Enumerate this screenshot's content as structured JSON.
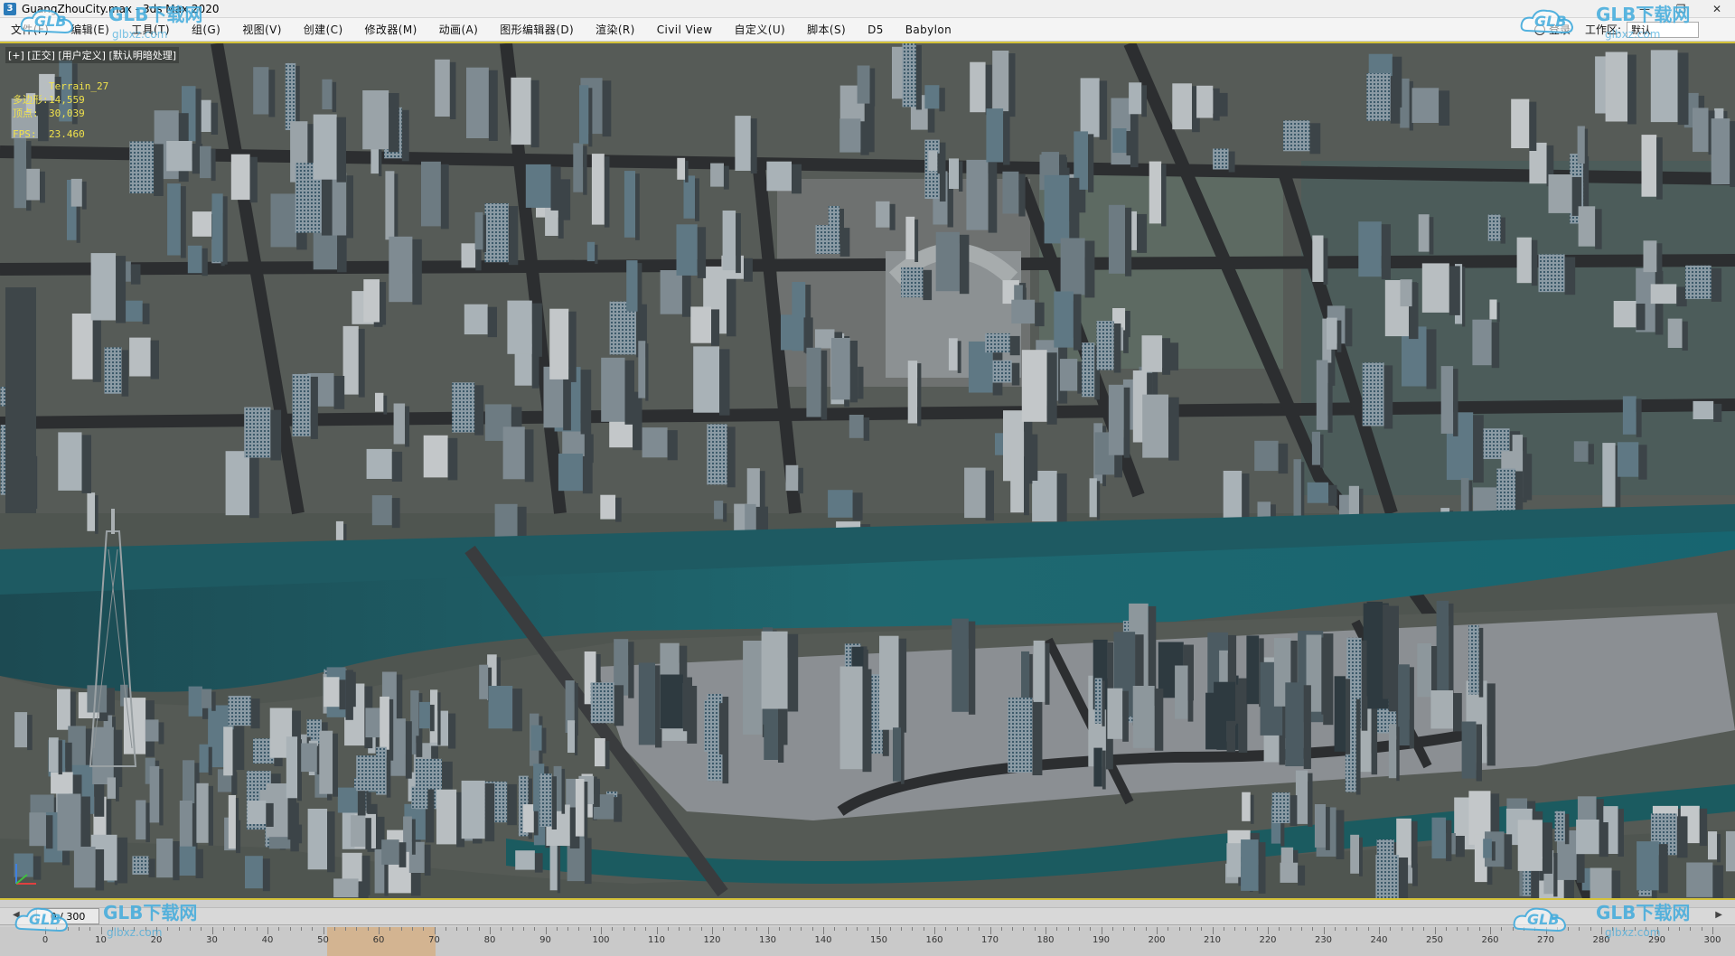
{
  "window": {
    "title": "GuangZhouCity.max - 3ds Max 2020",
    "app_icon": "3"
  },
  "menubar": {
    "items": [
      "文件(F)",
      "编辑(E)",
      "工具(T)",
      "组(G)",
      "视图(V)",
      "创建(C)",
      "修改器(M)",
      "动画(A)",
      "图形编辑器(D)",
      "渲染(R)",
      "Civil View",
      "自定义(U)",
      "脚本(S)",
      "D5",
      "Babylon"
    ],
    "login_label": "登录",
    "workspace_label": "工作区:",
    "workspace_value": "默认"
  },
  "viewport": {
    "label": "[+] [正交] [用户定义] [默认明暗处理]",
    "stats_title": "Terrain_27",
    "stats": [
      {
        "key": "多边形:",
        "value": "14,559"
      },
      {
        "key": "顶点:",
        "value": "30,039"
      },
      {
        "key": "FPS:",
        "value": "23.460"
      }
    ]
  },
  "timeline": {
    "frame_display": "0 / 300",
    "ticks": [
      0,
      10,
      20,
      30,
      40,
      50,
      60,
      70,
      80,
      90,
      100,
      110,
      120,
      130,
      140,
      150,
      160,
      170,
      180,
      190,
      200,
      210,
      220,
      230,
      240,
      250,
      260,
      270,
      280,
      290,
      300
    ],
    "prev_icon": "prev-arrow-icon",
    "next_icon": "next-arrow-icon"
  },
  "watermarks": {
    "brand": "GLB下载网",
    "logo_text": "GLB",
    "url": "glbxz.com"
  }
}
